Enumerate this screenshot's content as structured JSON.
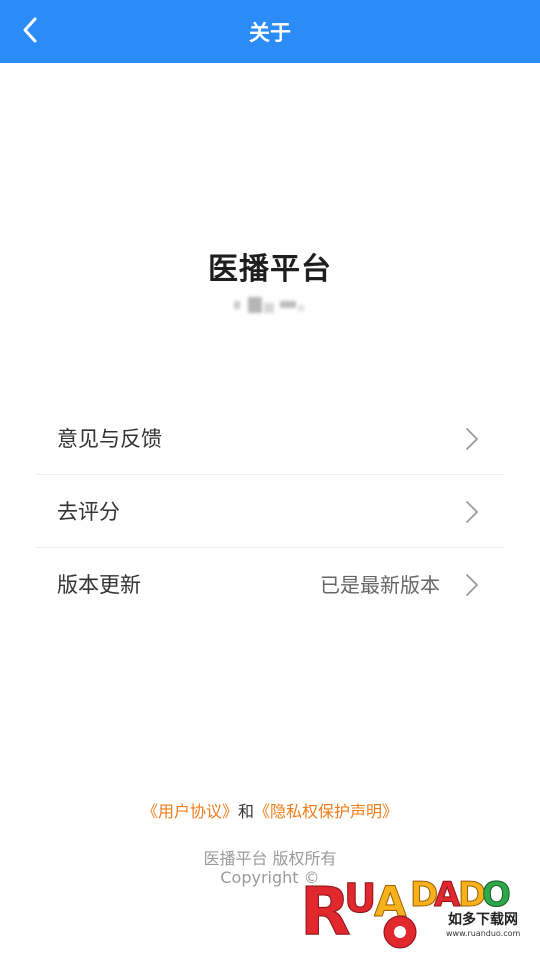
{
  "header": {
    "title": "关于",
    "back_icon": "chevron-left-icon",
    "background": "#2b8cf7"
  },
  "app": {
    "name": "医播平台"
  },
  "menu": {
    "items": [
      {
        "label": "意见与反馈",
        "value": ""
      },
      {
        "label": "去评分",
        "value": ""
      },
      {
        "label": "版本更新",
        "value": "已是最新版本"
      }
    ]
  },
  "footer": {
    "user_agreement": "《用户协议》",
    "connector": "和",
    "privacy_statement": "《隐私权保护声明》",
    "rights": "医播平台 版权所有",
    "copyright": "Copyright ©",
    "link_color": "#f07d1c"
  },
  "watermark": {
    "brand": "RUANDUO",
    "tagline": "如多下载网",
    "url": "www.ruanduo.com"
  }
}
